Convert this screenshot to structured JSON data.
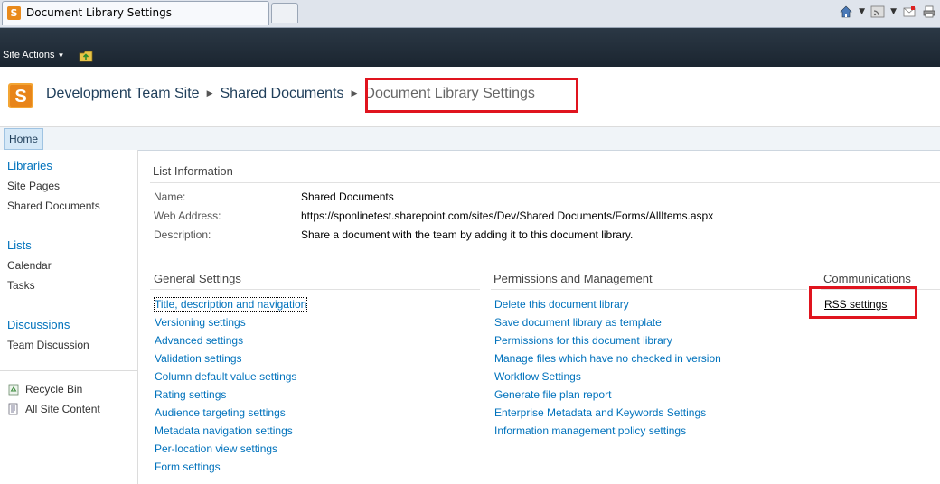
{
  "browser": {
    "tab_title": "Document Library Settings"
  },
  "ribbon": {
    "site_actions": "Site Actions"
  },
  "breadcrumb": {
    "site": "Development Team Site",
    "library": "Shared Documents",
    "current": "Document Library Settings"
  },
  "topnav": {
    "home": "Home"
  },
  "leftnav": {
    "libraries_heading": "Libraries",
    "libraries": [
      "Site Pages",
      "Shared Documents"
    ],
    "lists_heading": "Lists",
    "lists": [
      "Calendar",
      "Tasks"
    ],
    "discussions_heading": "Discussions",
    "discussions": [
      "Team Discussion"
    ],
    "recycle_bin": "Recycle Bin",
    "all_site_content": "All Site Content"
  },
  "list_info": {
    "heading": "List Information",
    "name_label": "Name:",
    "name_value": "Shared Documents",
    "web_label": "Web Address:",
    "web_value": "https://sponlinetest.sharepoint.com/sites/Dev/Shared Documents/Forms/AllItems.aspx",
    "desc_label": "Description:",
    "desc_value": "Share a document with the team by adding it to this document library."
  },
  "general_settings": {
    "heading": "General Settings",
    "links": [
      "Title, description and navigation",
      "Versioning settings",
      "Advanced settings",
      "Validation settings",
      "Column default value settings",
      "Rating settings",
      "Audience targeting settings",
      "Metadata navigation settings",
      "Per-location view settings",
      "Form settings"
    ]
  },
  "permissions": {
    "heading": "Permissions and Management",
    "links": [
      "Delete this document library",
      "Save document library as template",
      "Permissions for this document library",
      "Manage files which have no checked in version",
      "Workflow Settings",
      "Generate file plan report",
      "Enterprise Metadata and Keywords Settings",
      "Information management policy settings"
    ]
  },
  "communications": {
    "heading": "Communications",
    "links": [
      "RSS settings"
    ]
  },
  "colors": {
    "ribbon": "#1f2a36",
    "link": "#0072bc",
    "highlight": "#e0141e"
  }
}
